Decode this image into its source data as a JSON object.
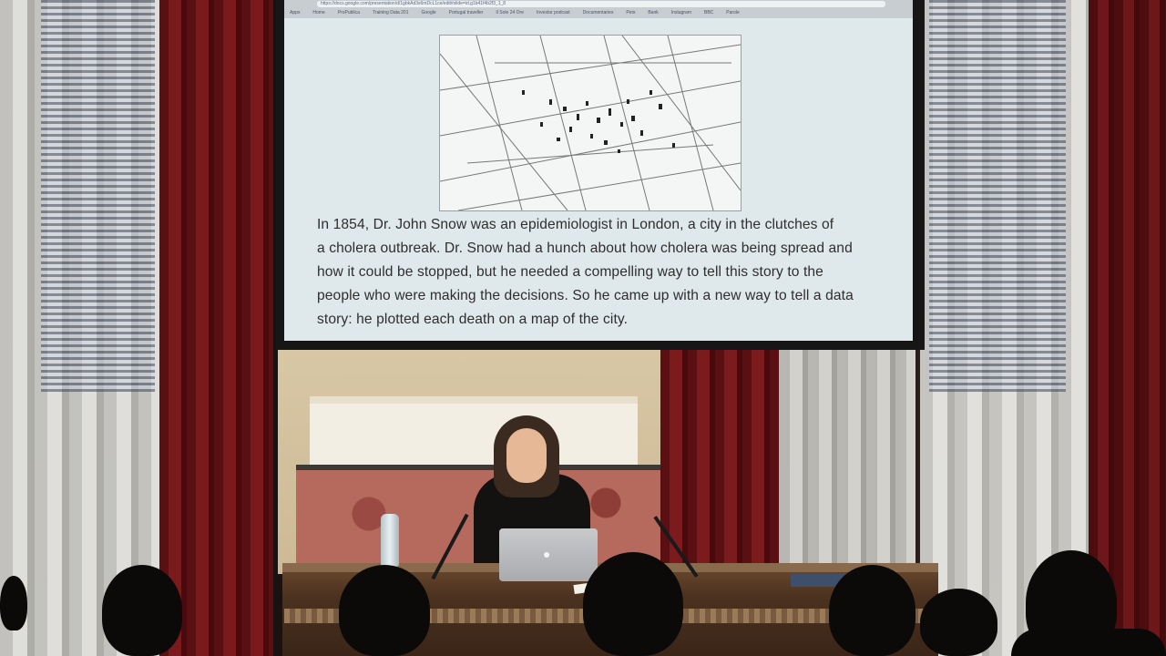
{
  "screen": {
    "browser": {
      "url": "https://docs.google.com/presentation/d/1gbkAd3s6mDcL1ce/edit#slide=id.g1b41f4b2f3_1_8",
      "bookmarks": [
        "Apps",
        "Home",
        "ProPublica",
        "Training Data 201",
        "Google",
        "Portugal traveller",
        "Il Sole 24 Ore",
        "Investor podcast",
        "Documentaries",
        "Pets",
        "Bank",
        "Instagram",
        "BBC",
        "Parole"
      ]
    },
    "slide": {
      "map_alt": "map-image",
      "caption_lines": [
        "In 1854, Dr. John Snow was an epidemiologist in London, a city in the clutches of",
        "a cholera outbreak. Dr. Snow had a hunch about how cholera was being spread and",
        "how it could be stopped, but he needed a compelling way to tell this story to the",
        "people who were making the decisions. So he came up with a new way to tell a data",
        "story: he plotted each death on a map of the city."
      ]
    }
  },
  "scene": {
    "laptop_logo": ""
  }
}
